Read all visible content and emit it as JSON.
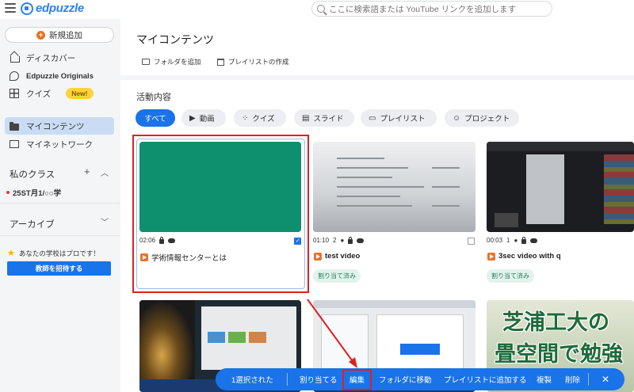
{
  "search": {
    "placeholder": "ここに検索語または YouTube リンクを追加します"
  },
  "brand": {
    "name": "edpuzzle"
  },
  "sidebar": {
    "new_button": "新規追加",
    "items": [
      {
        "label": "ディスカバー",
        "icon": "house-icon"
      },
      {
        "label": "Edpuzzle Originals",
        "icon": "originals-icon"
      },
      {
        "label": "クイズ",
        "icon": "grid-icon",
        "badge": "New!"
      },
      {
        "label": "マイコンテンツ",
        "icon": "folder-icon",
        "active": true
      },
      {
        "label": "マイネットワーク",
        "icon": "network-icon"
      }
    ],
    "classes_title": "私のクラス",
    "class_item": "25ST月1/○○学",
    "archive_title": "アーカイブ",
    "promo_text": "あなたの学校はプロです！",
    "invite_button": "教師を招待する"
  },
  "main": {
    "title": "マイコンテンツ",
    "add_folder": "フォルダを追加",
    "create_playlist": "プレイリストの作成",
    "activity_title": "活動内容",
    "filters": [
      "すべて",
      "動画",
      "クイズ",
      "スライド",
      "プレイリスト",
      "プロジェクト"
    ]
  },
  "cards": [
    {
      "duration": "02:06",
      "title": "学術情報センターとは",
      "checked": true
    },
    {
      "duration": "01:10",
      "questions": "2",
      "title": "test video",
      "assigned": "割り当て済み"
    },
    {
      "duration": "00:03",
      "questions": "1",
      "title": "3sec video with q",
      "assigned": "割り当て済み"
    }
  ],
  "thumb_text": {
    "line1": "芝浦工大の",
    "line2": "畳空間で勉強"
  },
  "action_bar": {
    "selected": "1選択された",
    "assign": "割り当てる",
    "edit": "編集",
    "move": "フォルダに移動",
    "add_playlist": "プレイリストに追加する",
    "duplicate": "複製",
    "delete": "削除"
  },
  "colors": {
    "accent": "#1a73e8",
    "highlight": "#e02020",
    "green_thumb": "#0e8f6d",
    "brand": "#2f80ed"
  }
}
